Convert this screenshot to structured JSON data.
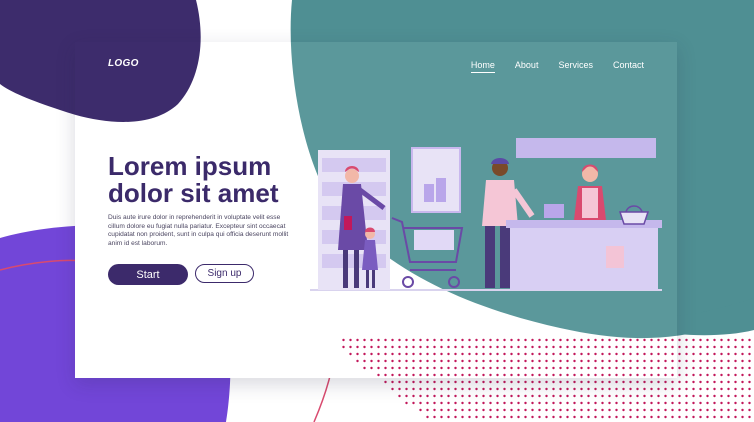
{
  "brand": {
    "logo": "LOGO"
  },
  "nav": {
    "items": [
      "Home",
      "About",
      "Services",
      "Contact"
    ],
    "active": "Home"
  },
  "hero": {
    "headline_line1": "Lorem ipsum",
    "headline_line2": "dolor sit amet",
    "body": "Duis aute irure dolor in reprehenderit in voluptate velit esse cillum dolore eu fugiat nulla pariatur. Excepteur sint occaecat cupidatat non proident, sunt in culpa qui officia deserunt mollit anim id est laborum.",
    "primary_button": "Start",
    "secondary_button": "Sign up"
  },
  "illustration": {
    "scene": "people-shopping-at-store-checkout-icon"
  },
  "colors": {
    "teal": "#4f8f93",
    "deep_purple": "#3c2a6b",
    "violet": "#7246d8",
    "accent_pink": "#c2185b",
    "lilac": "#c9b8ee",
    "white": "#ffffff"
  }
}
